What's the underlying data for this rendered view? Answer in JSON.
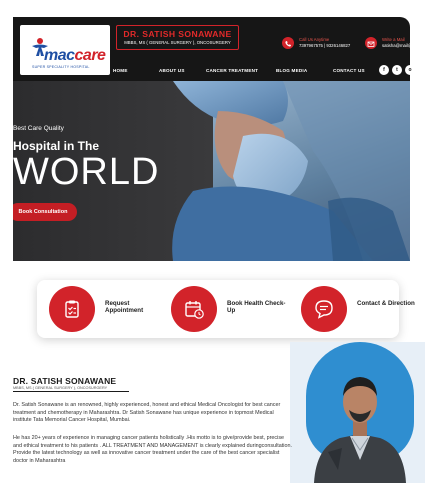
{
  "brand": {
    "logo_main": "mac",
    "logo_accent": "care",
    "logo_sub": "SUPER SPECIALITY HOSPITAL",
    "doctor_name": "DR. SATISH SONAWANE",
    "doctor_quals": "MBBS, MS ( GENERAL SURGERY ), ONCOSURGERY"
  },
  "contact": {
    "call_label": "Call Us Anytime",
    "call_value": "7397967575 | 9326146827",
    "mail_label": "Write a Mail",
    "mail_value": "satisha@mail@"
  },
  "nav": {
    "items": [
      "HOME",
      "ABOUT US",
      "CANCER TREATMENT",
      "BLOG MEDIA",
      "CONTACT US"
    ]
  },
  "social": {
    "icons": [
      "facebook-icon",
      "twitter-icon",
      "instagram-icon"
    ],
    "glyphs": [
      "f",
      "t",
      "o"
    ]
  },
  "hero": {
    "kicker": "Best Care Quality",
    "line1": "Hospital in The",
    "line2": "WORLD",
    "cta": "Book Consultation"
  },
  "services": {
    "items": [
      {
        "label": "Request Appointment",
        "icon": "clipboard-check-icon"
      },
      {
        "label": "Book Health Check-Up",
        "icon": "calendar-clock-icon"
      },
      {
        "label": "Contact & Direction",
        "icon": "chat-bubble-icon"
      }
    ]
  },
  "about": {
    "title": "DR. SATISH SONAWANE",
    "subtitle": "MBBS, MS ( GENERAL SURGERY ), ONCOSURGERY",
    "p1": "Dr. Satish Sonawane is an renowned, highly experienced, honest and ethical Medical Oncologist for best cancer treatment and chemotherapy in Maharashtra. Dr Satish Sonawane has unique experience in topmost Medical institute Tata Memorial Cancer Hospital, Mumbai.",
    "p2": "He has 20+ years of experience in managing cancer patients holistically .His motto is to give/provide best, precise and ethical treatment to his patients . ALL TREATMENT AND MANAGEMENT is clearly explained duringconsultation. Provide the latest technology as well as innovative cancer treatment under the care of the best cancer specialist doctor in Maharashtra"
  },
  "colors": {
    "accent": "#d2232a",
    "header_bg": "#161616",
    "brand_blue": "#1f4fa3"
  }
}
